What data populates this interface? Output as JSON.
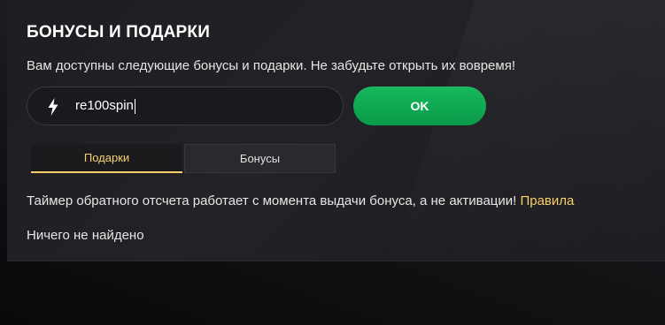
{
  "bonuses": {
    "title": "БОНУСЫ И ПОДАРКИ",
    "subtitle": "Вам доступны следующие бонусы и подарки. Не забудьте открыть их вовремя!",
    "promo_input": {
      "value": "re100spin",
      "icon": "lightning-icon"
    },
    "ok_label": "OK",
    "tabs": [
      {
        "label": "Подарки",
        "active": true
      },
      {
        "label": "Бонусы",
        "active": false
      }
    ],
    "timer_note": "Таймер обратного отсчета работает с момента выдачи бонуса, а не активации! ",
    "rules_link": "Правила",
    "empty_message": "Ничего не найдено"
  },
  "colors": {
    "accent_gold": "#f7d06b",
    "ok_green": "#0fa852",
    "panel_bg": "#212024"
  }
}
